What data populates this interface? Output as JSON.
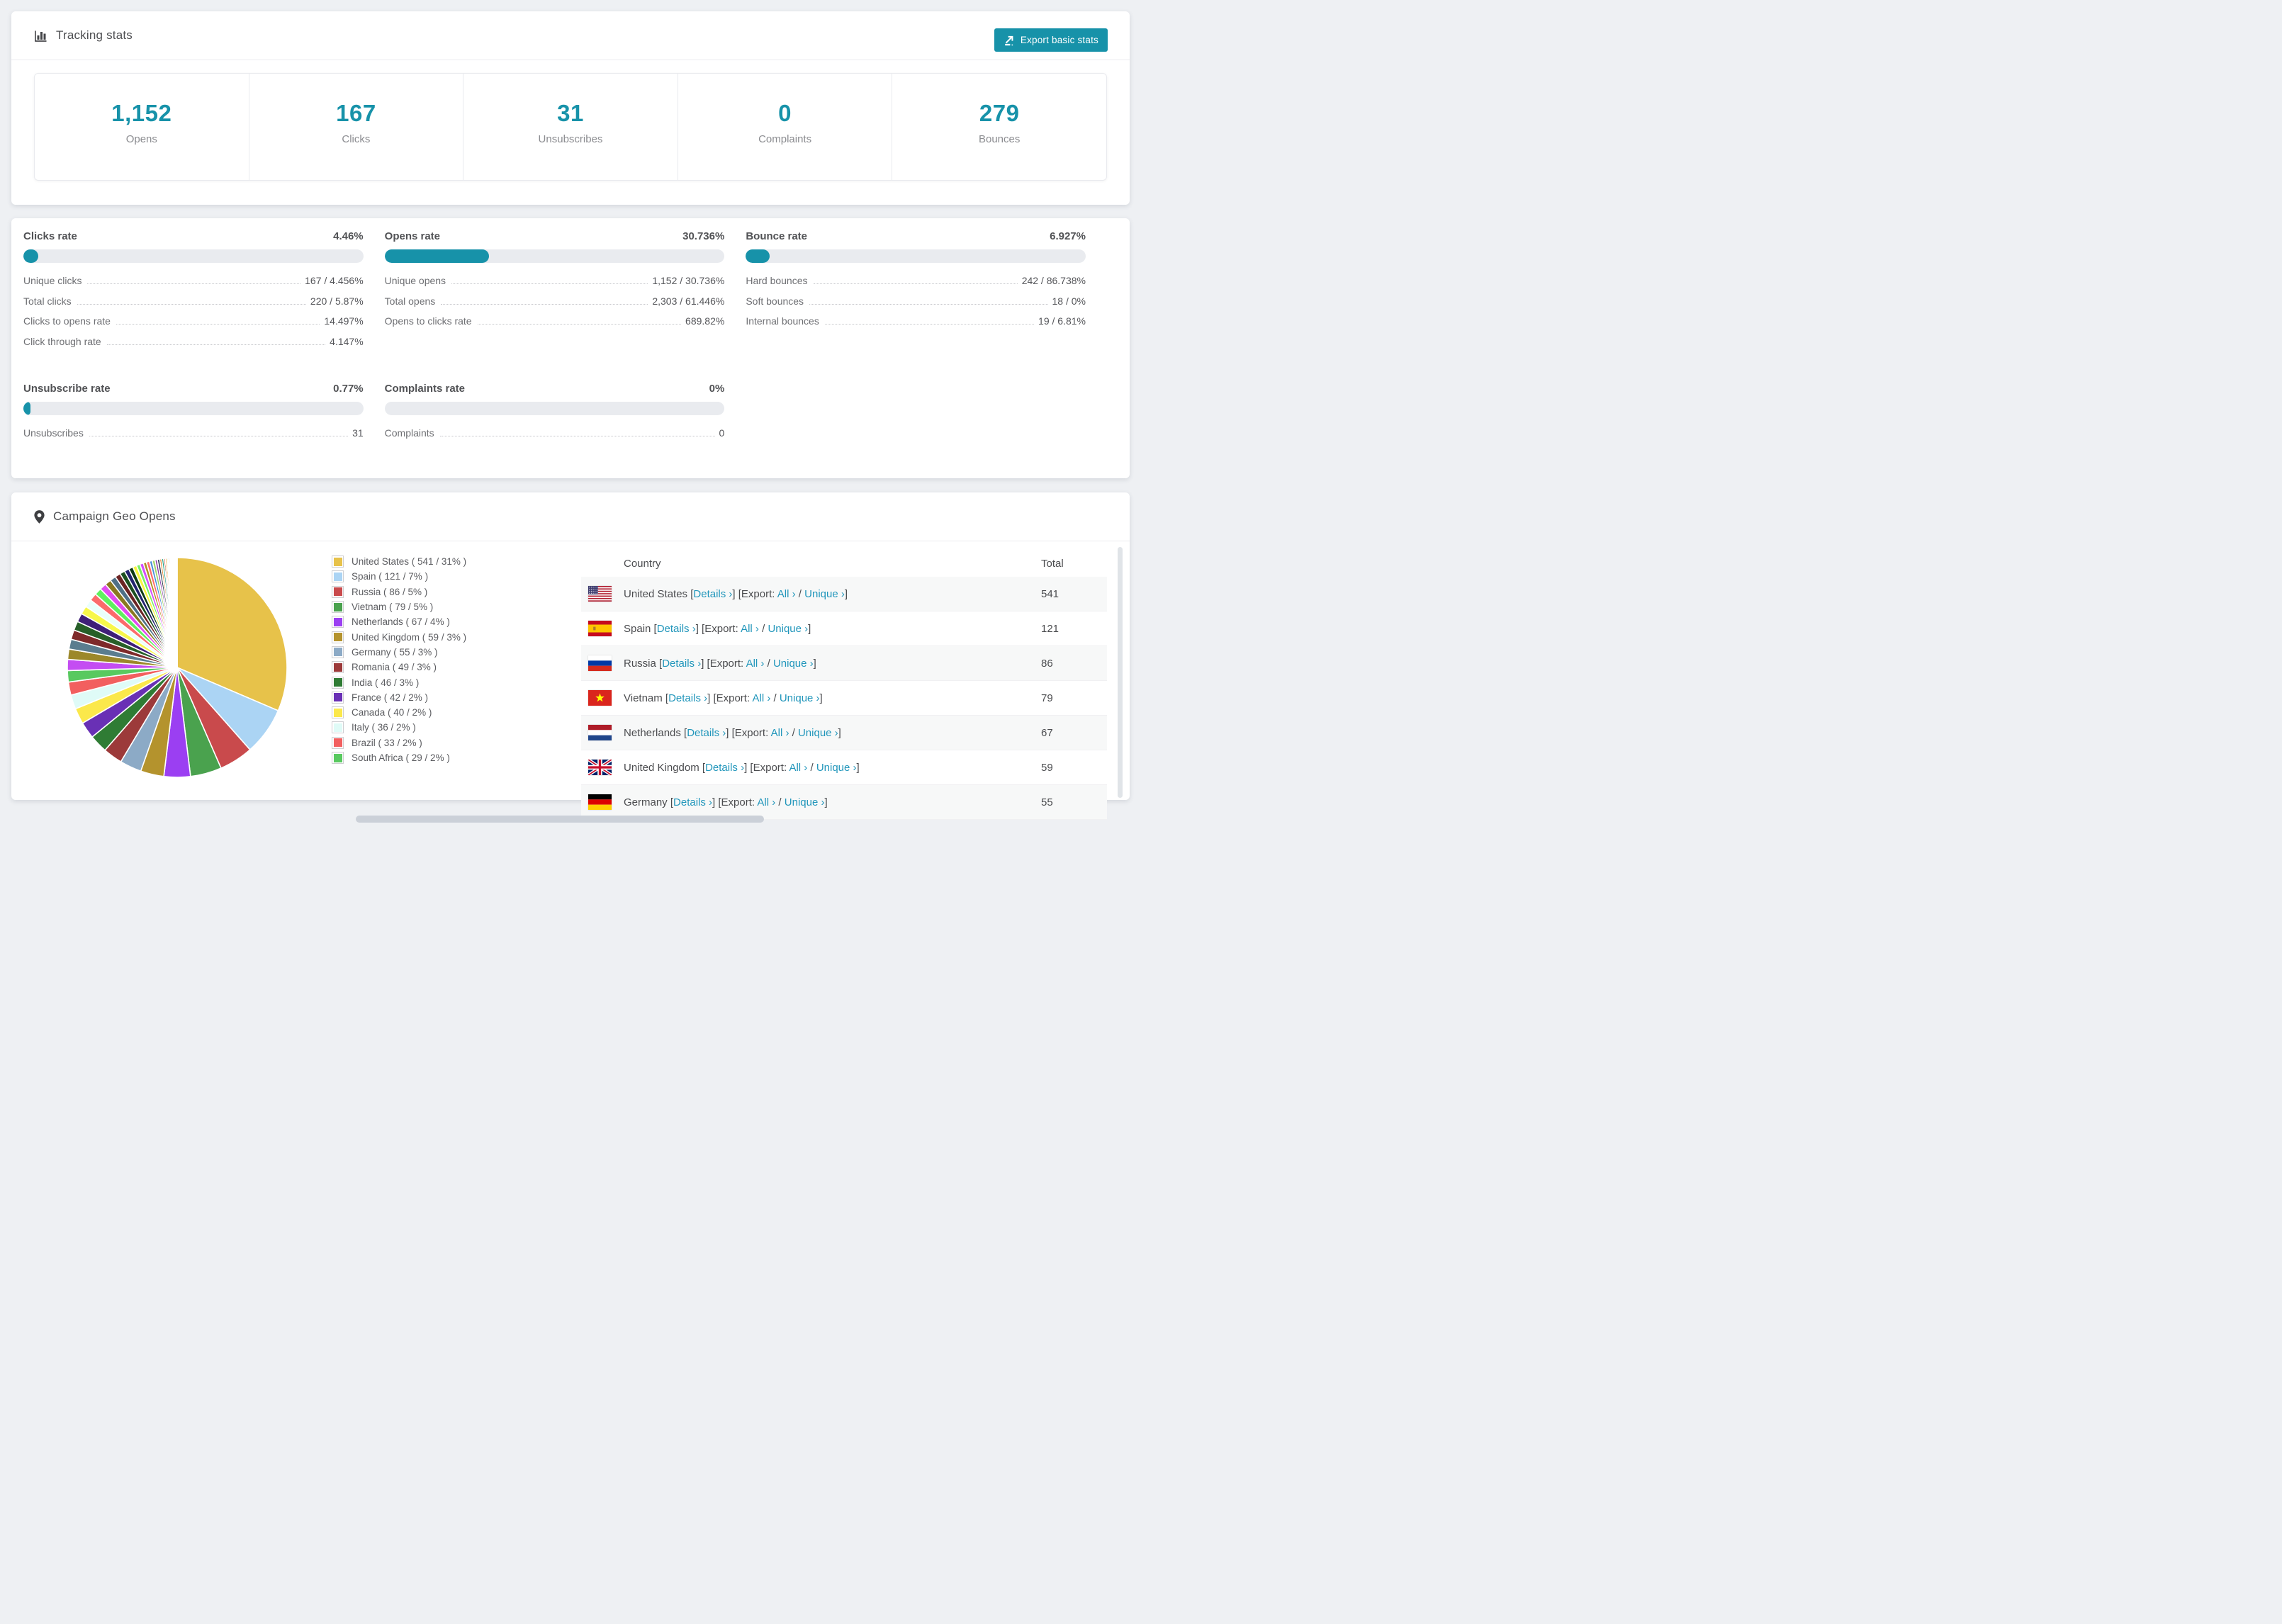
{
  "theme": {
    "accent": "#1792a9",
    "link_color": "#2196bb",
    "page_bg": "#eef0f3",
    "bar_track": "#e9ebef",
    "row_stripe": "#f7f8f8"
  },
  "tracking": {
    "title": "Tracking stats",
    "export_button": "Export basic stats",
    "stats": [
      {
        "value": "1,152",
        "label": "Opens"
      },
      {
        "value": "167",
        "label": "Clicks"
      },
      {
        "value": "31",
        "label": "Unsubscribes"
      },
      {
        "value": "0",
        "label": "Complaints"
      },
      {
        "value": "279",
        "label": "Bounces"
      }
    ]
  },
  "rates": {
    "blocks": [
      {
        "title": "Clicks rate",
        "value": "4.46%",
        "progress": 4.46,
        "rows": [
          {
            "label": "Unique clicks",
            "value": "167 / 4.456%"
          },
          {
            "label": "Total clicks",
            "value": "220 / 5.87%"
          },
          {
            "label": "Clicks to opens rate",
            "value": "14.497%"
          },
          {
            "label": "Click through rate",
            "value": "4.147%"
          }
        ]
      },
      {
        "title": "Opens rate",
        "value": "30.736%",
        "progress": 30.736,
        "rows": [
          {
            "label": "Unique opens",
            "value": "1,152 / 30.736%"
          },
          {
            "label": "Total opens",
            "value": "2,303 / 61.446%"
          },
          {
            "label": "Opens to clicks rate",
            "value": "689.82%"
          }
        ]
      },
      {
        "title": "Bounce rate",
        "value": "6.927%",
        "progress": 6.927,
        "rows": [
          {
            "label": "Hard bounces",
            "value": "242 / 86.738%"
          },
          {
            "label": "Soft bounces",
            "value": "18 / 0%"
          },
          {
            "label": "Internal bounces",
            "value": "19 / 6.81%"
          }
        ]
      },
      {
        "title": "Unsubscribe rate",
        "value": "0.77%",
        "progress": 0.77,
        "rows": [
          {
            "label": "Unsubscribes",
            "value": "31"
          }
        ]
      },
      {
        "title": "Complaints rate",
        "value": "0%",
        "progress": 0,
        "rows": [
          {
            "label": "Complaints",
            "value": "0"
          }
        ]
      }
    ]
  },
  "geo": {
    "title": "Campaign Geo Opens",
    "table": {
      "columns": [
        "Country",
        "Total"
      ],
      "details_label": "Details ›",
      "export_prefix": "[Export:",
      "all_label": "All ›",
      "separator": "/",
      "unique_label": "Unique ›",
      "rows": [
        {
          "country": "United States",
          "total": "541",
          "flag": "us"
        },
        {
          "country": "Spain",
          "total": "121",
          "flag": "es"
        },
        {
          "country": "Russia",
          "total": "86",
          "flag": "ru"
        },
        {
          "country": "Vietnam",
          "total": "79",
          "flag": "vn"
        },
        {
          "country": "Netherlands",
          "total": "67",
          "flag": "nl"
        },
        {
          "country": "United Kingdom",
          "total": "59",
          "flag": "gb"
        },
        {
          "country": "Germany",
          "total": "55",
          "flag": "de"
        }
      ]
    }
  },
  "chart_data": {
    "type": "pie",
    "title": "Campaign Geo Opens",
    "legend_position": "right",
    "series": [
      {
        "label": "United States",
        "value": 541,
        "pct": "31%",
        "color": "#e7c24a",
        "legend": "United States ( 541 / 31% )"
      },
      {
        "label": "Spain",
        "value": 121,
        "pct": "7%",
        "color": "#abd4f4",
        "legend": "Spain ( 121 / 7% )"
      },
      {
        "label": "Russia",
        "value": 86,
        "pct": "5%",
        "color": "#c94a4c",
        "legend": "Russia ( 86 / 5% )"
      },
      {
        "label": "Vietnam",
        "value": 79,
        "pct": "5%",
        "color": "#4aa24e",
        "legend": "Vietnam ( 79 / 5% )"
      },
      {
        "label": "Netherlands",
        "value": 67,
        "pct": "4%",
        "color": "#9b3ff2",
        "legend": "Netherlands ( 67 / 4% )"
      },
      {
        "label": "United Kingdom",
        "value": 59,
        "pct": "3%",
        "color": "#b4932d",
        "legend": "United Kingdom ( 59 / 3% )"
      },
      {
        "label": "Germany",
        "value": 55,
        "pct": "3%",
        "color": "#8caac6",
        "legend": "Germany ( 55 / 3% )"
      },
      {
        "label": "Romania",
        "value": 49,
        "pct": "3%",
        "color": "#9c3a3a",
        "legend": "Romania ( 49 / 3% )"
      },
      {
        "label": "India",
        "value": 46,
        "pct": "3%",
        "color": "#2f7c34",
        "legend": "India ( 46 / 3% )"
      },
      {
        "label": "France",
        "value": 42,
        "pct": "2%",
        "color": "#6930b5",
        "legend": "France ( 42 / 2% )"
      },
      {
        "label": "Canada",
        "value": 40,
        "pct": "2%",
        "color": "#fbe84b",
        "legend": "Canada ( 40 / 2% )"
      },
      {
        "label": "Italy",
        "value": 36,
        "pct": "2%",
        "color": "#dffbf7",
        "legend": "Italy ( 36 / 2% )"
      },
      {
        "label": "Brazil",
        "value": 33,
        "pct": "2%",
        "color": "#f25f5f",
        "legend": "Brazil ( 33 / 2% )"
      },
      {
        "label": "South Africa",
        "value": 29,
        "pct": "2%",
        "color": "#58c95f",
        "legend": "South Africa ( 29 / 2% )"
      }
    ],
    "others_unlabeled": {
      "values": [
        28,
        26,
        25,
        24,
        23,
        22,
        21,
        20,
        19,
        18,
        17,
        16,
        15,
        14,
        13,
        12,
        11,
        10,
        9,
        9,
        8,
        8,
        7,
        7,
        6,
        6,
        5,
        5,
        4,
        4,
        3,
        3,
        3,
        2,
        2,
        2,
        2,
        1,
        1,
        1,
        1,
        1,
        1,
        1,
        1,
        1
      ],
      "colors": [
        "#c44df2",
        "#9c882a",
        "#5b7d8f",
        "#7e2a2a",
        "#275f28",
        "#3f1f78",
        "#f7f74a",
        "#e9fffb",
        "#fb6b6b",
        "#5ef05e",
        "#e04df0",
        "#8a7820",
        "#4f7086",
        "#6b2424",
        "#1d4f20",
        "#23236e",
        "#0f3a14",
        "#f5f542",
        "#77ee66",
        "#d44dff",
        "#b09020",
        "#ff6b6b",
        "#4a90d9",
        "#a0d468",
        "#8e44ad",
        "#2c3e50",
        "#e67e22",
        "#16a085",
        "#c0392b",
        "#f39c12",
        "#27ae60",
        "#2980b9",
        "#8b4513",
        "#ff69b4",
        "#00ced1",
        "#9370db",
        "#3cb371",
        "#b8860b",
        "#dc143c",
        "#708090",
        "#6b8e23",
        "#483d8b",
        "#cd5c5c",
        "#20b2aa",
        "#daa520",
        "#9932cc"
      ]
    }
  }
}
